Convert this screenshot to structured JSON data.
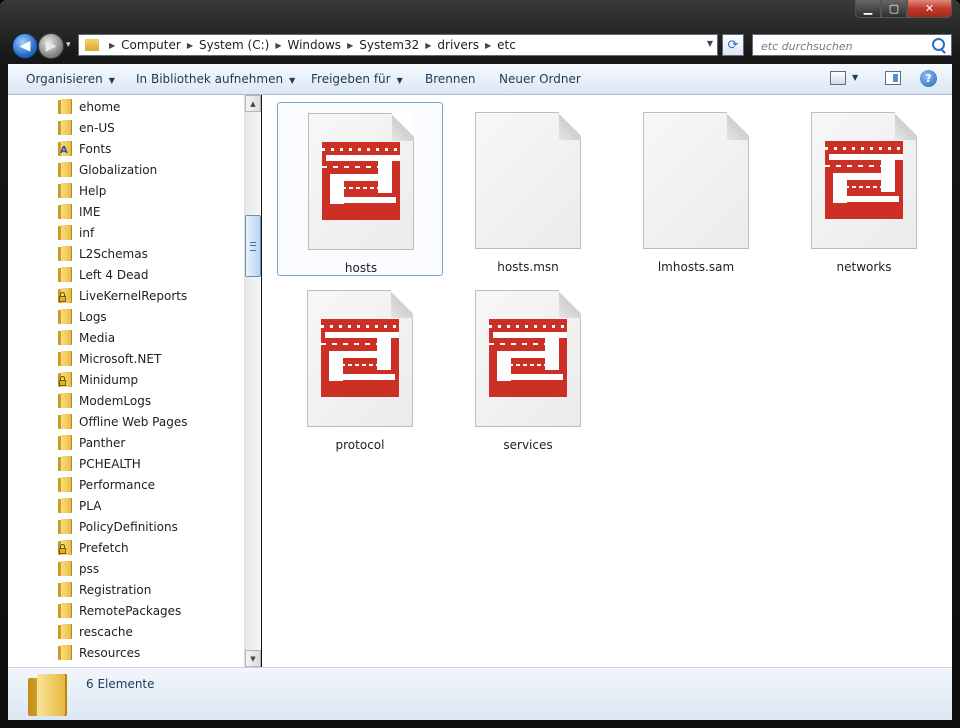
{
  "window": {
    "caption_buttons": {
      "minimize": "▁",
      "maximize": "▢",
      "close": "✕"
    }
  },
  "nav": {
    "back_glyph": "◀",
    "forward_glyph": "▶",
    "history_dropdown_glyph": "▾",
    "breadcrumb": [
      {
        "label": "Computer"
      },
      {
        "label": "System (C:)"
      },
      {
        "label": "Windows"
      },
      {
        "label": "System32"
      },
      {
        "label": "drivers"
      },
      {
        "label": "etc"
      }
    ],
    "separator_glyph": "▶",
    "address_dropdown_glyph": "▼",
    "refresh_glyph": "⟳",
    "search_placeholder": "etc durchsuchen"
  },
  "toolbar": {
    "organize": "Organisieren",
    "include_library": "In Bibliothek aufnehmen",
    "share": "Freigeben für",
    "burn": "Brennen",
    "new_folder": "Neuer Ordner",
    "dropdown_glyph": "▼",
    "help_glyph": "?"
  },
  "tree": {
    "items": [
      {
        "label": "ehome",
        "icon": "folder-icon"
      },
      {
        "label": "en-US",
        "icon": "folder-icon"
      },
      {
        "label": "Fonts",
        "icon": "fonts-folder-icon"
      },
      {
        "label": "Globalization",
        "icon": "folder-icon"
      },
      {
        "label": "Help",
        "icon": "folder-icon"
      },
      {
        "label": "IME",
        "icon": "folder-icon"
      },
      {
        "label": "inf",
        "icon": "folder-icon"
      },
      {
        "label": "L2Schemas",
        "icon": "folder-icon"
      },
      {
        "label": "Left 4 Dead",
        "icon": "folder-icon"
      },
      {
        "label": "LiveKernelReports",
        "icon": "locked-folder-icon"
      },
      {
        "label": "Logs",
        "icon": "folder-icon"
      },
      {
        "label": "Media",
        "icon": "folder-icon"
      },
      {
        "label": "Microsoft.NET",
        "icon": "folder-icon"
      },
      {
        "label": "Minidump",
        "icon": "locked-folder-icon"
      },
      {
        "label": "ModemLogs",
        "icon": "folder-icon"
      },
      {
        "label": "Offline Web Pages",
        "icon": "folder-icon"
      },
      {
        "label": "Panther",
        "icon": "folder-icon"
      },
      {
        "label": "PCHEALTH",
        "icon": "folder-icon"
      },
      {
        "label": "Performance",
        "icon": "folder-icon"
      },
      {
        "label": "PLA",
        "icon": "folder-icon"
      },
      {
        "label": "PolicyDefinitions",
        "icon": "folder-icon"
      },
      {
        "label": "Prefetch",
        "icon": "locked-folder-icon"
      },
      {
        "label": "pss",
        "icon": "folder-icon"
      },
      {
        "label": "Registration",
        "icon": "folder-icon"
      },
      {
        "label": "RemotePackages",
        "icon": "folder-icon"
      },
      {
        "label": "rescache",
        "icon": "folder-icon"
      },
      {
        "label": "Resources",
        "icon": "folder-icon"
      }
    ],
    "scroll_up_glyph": "▲",
    "scroll_down_glyph": "▼"
  },
  "files": [
    {
      "name": "hosts",
      "icon": "l4d-file-icon",
      "selected": true
    },
    {
      "name": "hosts.msn",
      "icon": "blank-file-icon",
      "selected": false
    },
    {
      "name": "lmhosts.sam",
      "icon": "blank-file-icon",
      "selected": false
    },
    {
      "name": "networks",
      "icon": "l4d-file-icon",
      "selected": false
    },
    {
      "name": "protocol",
      "icon": "l4d-file-icon",
      "selected": false
    },
    {
      "name": "services",
      "icon": "l4d-file-icon",
      "selected": false
    }
  ],
  "status": {
    "item_count": "6 Elemente"
  },
  "colors": {
    "accent_logo": "#cc2f23",
    "toolbar_text": "#1e395b",
    "selection_border": "#7da2ce"
  }
}
